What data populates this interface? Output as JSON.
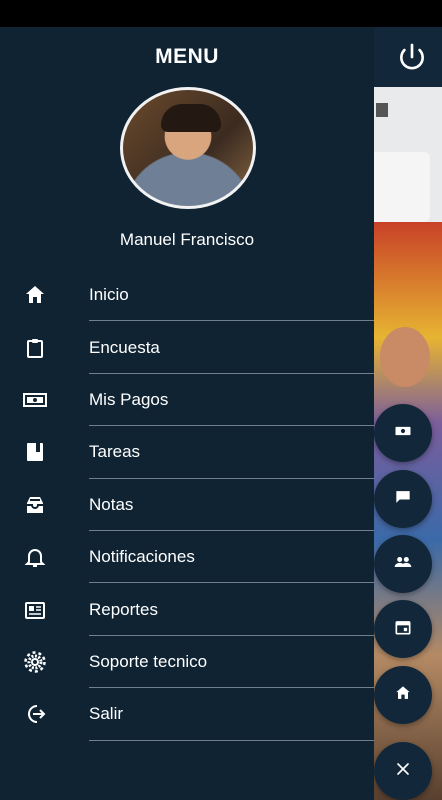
{
  "drawer": {
    "title": "MENU",
    "user_name": "Manuel Francisco",
    "items": [
      {
        "label": "Inicio",
        "icon": "home-icon"
      },
      {
        "label": "Encuesta",
        "icon": "clipboard-icon"
      },
      {
        "label": "Mis Pagos",
        "icon": "money-icon"
      },
      {
        "label": "Tareas",
        "icon": "book-icon"
      },
      {
        "label": "Notas",
        "icon": "inbox-icon"
      },
      {
        "label": "Notificaciones",
        "icon": "bell-icon"
      },
      {
        "label": "Reportes",
        "icon": "newspaper-icon"
      },
      {
        "label": "Soporte tecnico",
        "icon": "gear-icon"
      },
      {
        "label": "Salir",
        "icon": "logout-icon"
      }
    ]
  },
  "fabs": [
    "money-icon",
    "chat-icon",
    "people-icon",
    "calendar-icon",
    "home-icon",
    "close-icon"
  ],
  "colors": {
    "drawer_bg": "#0f2333",
    "text": "#ffffff",
    "divider": "#6f7f8c",
    "fab_bg": "#12283a"
  }
}
